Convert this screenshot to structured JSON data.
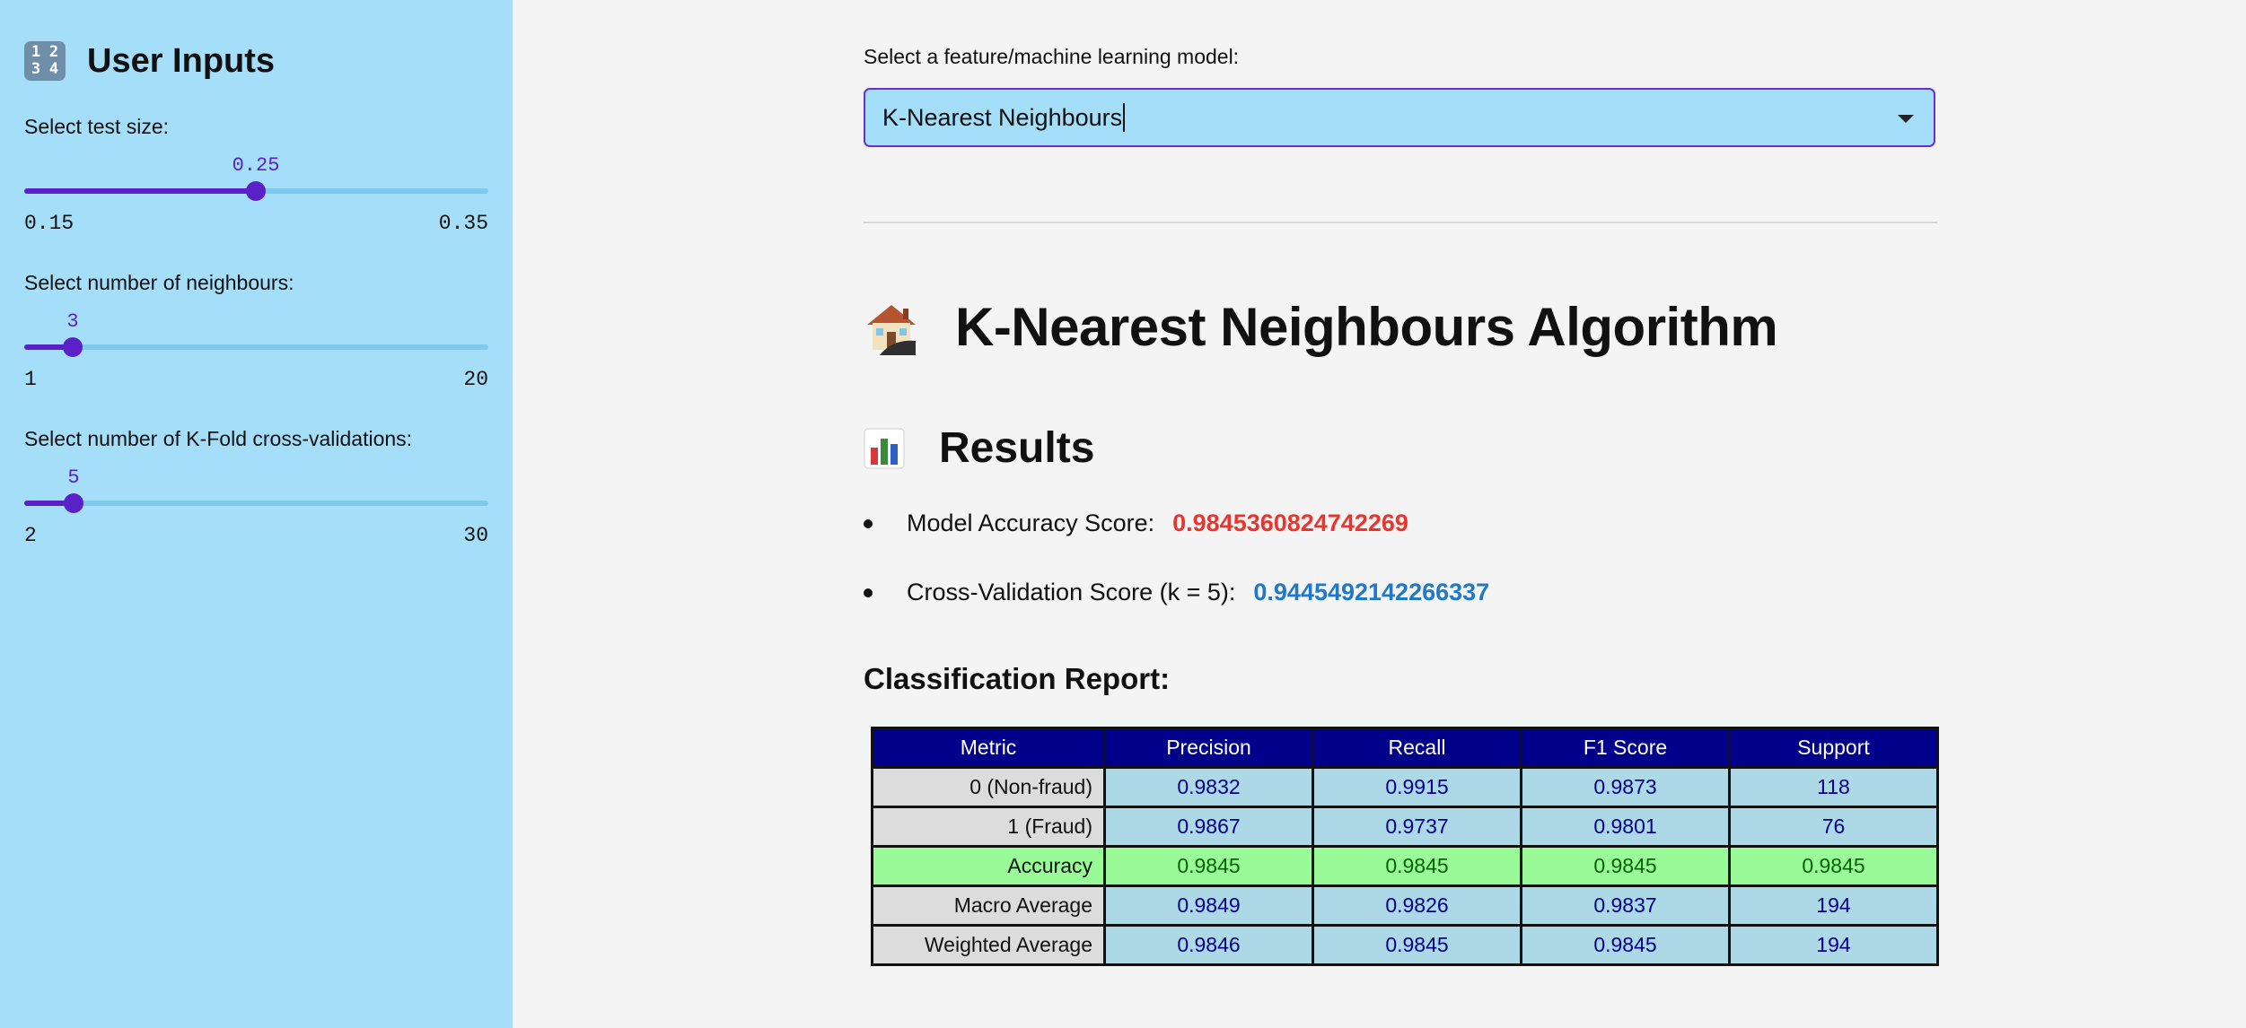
{
  "sidebar": {
    "icon": "input-numbers-icon",
    "icon_digits": [
      "1",
      "2",
      "3",
      "4"
    ],
    "title": "User Inputs",
    "sliders": [
      {
        "label": "Select test size:",
        "value": "0.25",
        "min": "0.15",
        "max": "0.35",
        "fraction": 0.5
      },
      {
        "label": "Select number of neighbours:",
        "value": "3",
        "min": "1",
        "max": "20",
        "fraction": 0.105
      },
      {
        "label": "Select number of K-Fold cross-validations:",
        "value": "5",
        "min": "2",
        "max": "30",
        "fraction": 0.107
      }
    ]
  },
  "main": {
    "select_label": "Select a feature/machine learning model:",
    "select_value": "K-Nearest Neighbours",
    "heading": "K-Nearest Neighbours Algorithm",
    "heading_icon": "house-icon",
    "results_title": "Results",
    "results_icon": "bar-chart-icon",
    "accuracy_label": "Model Accuracy Score:",
    "accuracy_value": "0.9845360824742269",
    "cv_label": "Cross-Validation Score (k = 5):",
    "cv_value": "0.9445492142266337",
    "report_title": "Classification Report:",
    "report": {
      "headers": [
        "Metric",
        "Precision",
        "Recall",
        "F1 Score",
        "Support"
      ],
      "rows": [
        [
          "0 (Non-fraud)",
          "0.9832",
          "0.9915",
          "0.9873",
          "118"
        ],
        [
          "1 (Fraud)",
          "0.9867",
          "0.9737",
          "0.9801",
          "76"
        ],
        [
          "Accuracy",
          "0.9845",
          "0.9845",
          "0.9845",
          "0.9845"
        ],
        [
          "Macro Average",
          "0.9849",
          "0.9826",
          "0.9837",
          "194"
        ],
        [
          "Weighted Average",
          "0.9846",
          "0.9845",
          "0.9845",
          "194"
        ]
      ]
    }
  },
  "colors": {
    "sidebar_bg": "#a5def8",
    "accent": "#5b21c8",
    "accuracy_red": "#e8362f",
    "cv_blue": "#1f78c8",
    "table_header": "#00008b",
    "table_cell": "#add8e6",
    "table_accuracy": "#98fb98"
  }
}
